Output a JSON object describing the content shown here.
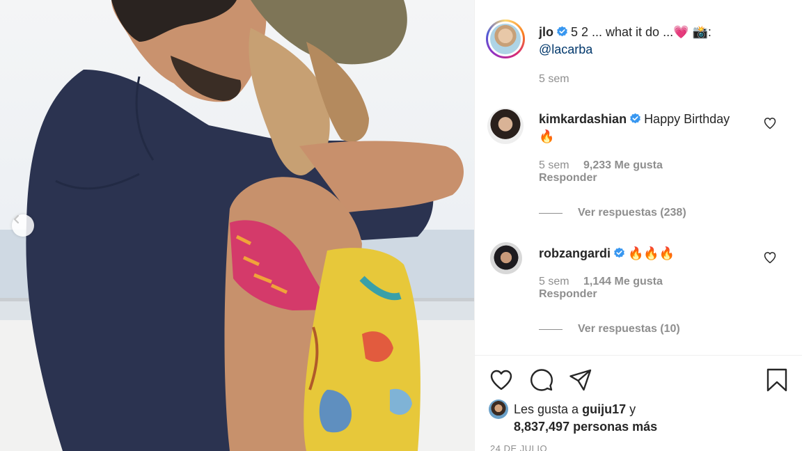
{
  "post": {
    "username": "jlo",
    "caption": "5 2 ... what it do ...💗 📸:",
    "credit": "@lacarba",
    "time": "5 sem"
  },
  "comments": [
    {
      "username": "kimkardashian",
      "text": "Happy Birthday 🔥",
      "time": "5 sem",
      "likes": "9,233 Me gusta",
      "reply": "Responder",
      "view_replies": "Ver respuestas (238)"
    },
    {
      "username": "robzangardi",
      "text": "🔥🔥🔥",
      "time": "5 sem",
      "likes": "1,144 Me gusta",
      "reply": "Responder",
      "view_replies": "Ver respuestas (10)"
    }
  ],
  "likes": {
    "prefix": "Les gusta a",
    "user": "guiju17",
    "connector": "y",
    "count": "8,837,497",
    "suffix": "personas más"
  },
  "date": "24 DE JULIO",
  "icons": {
    "like": "heart-icon",
    "comment": "comment-icon",
    "share": "share-icon",
    "save": "bookmark-icon",
    "carousel_prev": "chevron-left-icon",
    "verified": "verified-badge-icon"
  },
  "colors": {
    "verified": "#3897f0",
    "link": "#00376b",
    "muted": "#8e8e8e",
    "text": "#262626"
  }
}
